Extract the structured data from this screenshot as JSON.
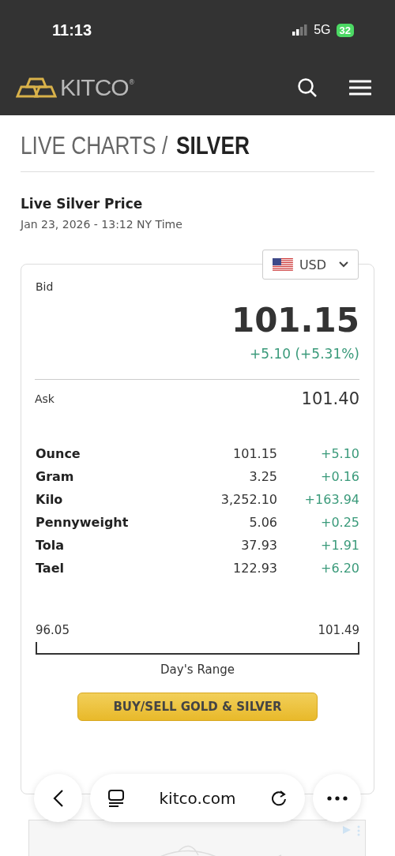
{
  "status_bar": {
    "time": "11:13",
    "network": "5G",
    "battery": "32"
  },
  "header": {
    "logo": "KITCO",
    "registered": "®"
  },
  "page_title": {
    "section": "LIVE CHARTS /",
    "metal": "SILVER"
  },
  "price_heading": {
    "title": "Live Silver Price",
    "timestamp": "Jan 23, 2026 - 13:12 NY Time"
  },
  "currency": {
    "value": "USD"
  },
  "bid": {
    "label": "Bid",
    "price": "101.15",
    "change": "+5.10 (+5.31%)"
  },
  "ask": {
    "label": "Ask",
    "price": "101.40"
  },
  "units": [
    {
      "unit": "Ounce",
      "price": "101.15",
      "change": "+5.10"
    },
    {
      "unit": "Gram",
      "price": "3.25",
      "change": "+0.16"
    },
    {
      "unit": "Kilo",
      "price": "3,252.10",
      "change": "+163.94"
    },
    {
      "unit": "Pennyweight",
      "price": "5.06",
      "change": "+0.25"
    },
    {
      "unit": "Tola",
      "price": "37.93",
      "change": "+1.91"
    },
    {
      "unit": "Tael",
      "price": "122.93",
      "change": "+6.20"
    }
  ],
  "day_range": {
    "low": "96.05",
    "high": "101.49",
    "label": "Day's Range"
  },
  "cta_button": "BUY/SELL GOLD & SILVER",
  "browser_bar": {
    "url": "kitco.com"
  }
}
